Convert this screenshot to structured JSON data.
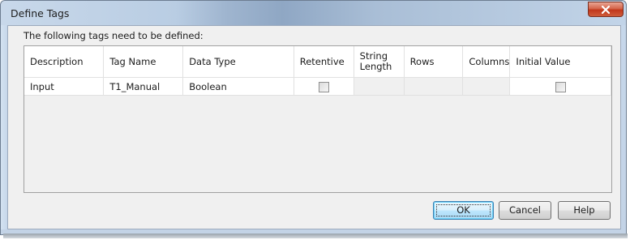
{
  "window": {
    "title": "Define Tags",
    "close_label": "Close"
  },
  "dialog": {
    "prompt": "The following tags need to be defined:"
  },
  "table": {
    "columns": [
      "Description",
      "Tag Name",
      "Data Type",
      "Retentive",
      "String Length",
      "Rows",
      "Columns",
      "Initial Value"
    ],
    "rows": [
      {
        "description": "Input",
        "tag_name": "T1_Manual",
        "data_type": "Boolean",
        "retentive": false,
        "string_length": "",
        "rows": "",
        "columns": "",
        "initial_value": false
      }
    ]
  },
  "buttons": {
    "ok": "OK",
    "cancel": "Cancel",
    "help": "Help"
  },
  "icons": {
    "close": "close-icon",
    "checkbox": "checkbox-unchecked"
  }
}
